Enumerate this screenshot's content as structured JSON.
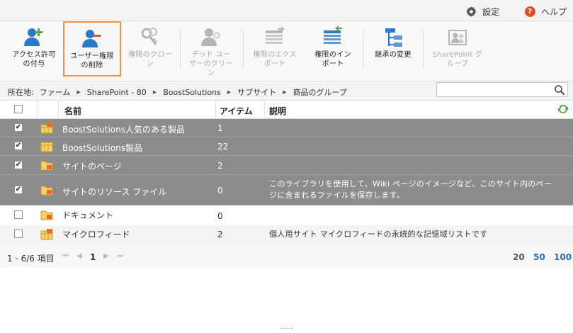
{
  "topbar": {
    "settings_label": "設定",
    "help_label": "ヘルプ",
    "settings_icon": "gear-icon",
    "help_icon": "help-icon"
  },
  "ribbon": {
    "buttons": [
      {
        "label": "アクセス許可\nの付与",
        "icon": "user-add-icon",
        "enabled": true,
        "selected": false
      },
      {
        "label": "ユーザー権限\nの削除",
        "icon": "user-remove-icon",
        "enabled": true,
        "selected": true
      },
      {
        "label": "権限のクロー\nン",
        "icon": "keys-icon",
        "enabled": false,
        "selected": false
      },
      {
        "label": "デッド ユー\nザーのクリー\nン",
        "icon": "user-clean-icon",
        "enabled": false,
        "selected": false
      },
      {
        "label": "権限のエクス\nポート",
        "icon": "export-icon",
        "enabled": false,
        "selected": false
      },
      {
        "label": "権限のイン\nポート",
        "icon": "import-icon",
        "enabled": true,
        "selected": false
      },
      {
        "label": "継承の変更",
        "icon": "inheritance-icon",
        "enabled": true,
        "selected": false
      },
      {
        "label": "SharePoint グ\nループ",
        "icon": "group-icon",
        "enabled": false,
        "selected": false
      }
    ]
  },
  "breadcrumb": {
    "label": "所在地:",
    "items": [
      "ファーム",
      "SharePoint - 80",
      "BoostSolutions",
      "サブサイト",
      "商品のグループ"
    ]
  },
  "search": {
    "placeholder": ""
  },
  "table": {
    "columns": {
      "name": "名前",
      "items": "アイテム",
      "description": "説明"
    },
    "rows": [
      {
        "name": "BoostSolutions人気のある製品",
        "count": "1",
        "description": "",
        "checked": true,
        "icon": "list-icon"
      },
      {
        "name": "BoostSolutions製品",
        "count": "22",
        "description": "",
        "checked": true,
        "icon": "list-icon"
      },
      {
        "name": "サイトのページ",
        "count": "2",
        "description": "",
        "checked": true,
        "icon": "library-icon"
      },
      {
        "name": "サイトのリソース ファイル",
        "count": "0",
        "description": "このライブラリを使用して、Wiki ページのイメージなど、このサイト内のページに含まれるファイルを保存します。",
        "checked": true,
        "icon": "library-icon"
      },
      {
        "name": "ドキュメント",
        "count": "0",
        "description": "",
        "checked": false,
        "icon": "library-icon"
      },
      {
        "name": "マイクロフィード",
        "count": "2",
        "description": "個人用サイト マイクロフィードの永続的な記憶域リストです",
        "checked": false,
        "icon": "list-icon"
      }
    ]
  },
  "pager": {
    "range": "1 - 6/6 項目",
    "current_page": "1",
    "first": "⏮",
    "prev": "◀",
    "next": "▶",
    "last": "⏭",
    "sizes": [
      "20",
      "50",
      "100"
    ]
  },
  "colors": {
    "selected_row": "#8c8c8c",
    "accent_green": "#5aa637",
    "accent_blue": "#2a78c6",
    "selected_button_border": "#e9964a",
    "link": "#2a6cb2"
  }
}
